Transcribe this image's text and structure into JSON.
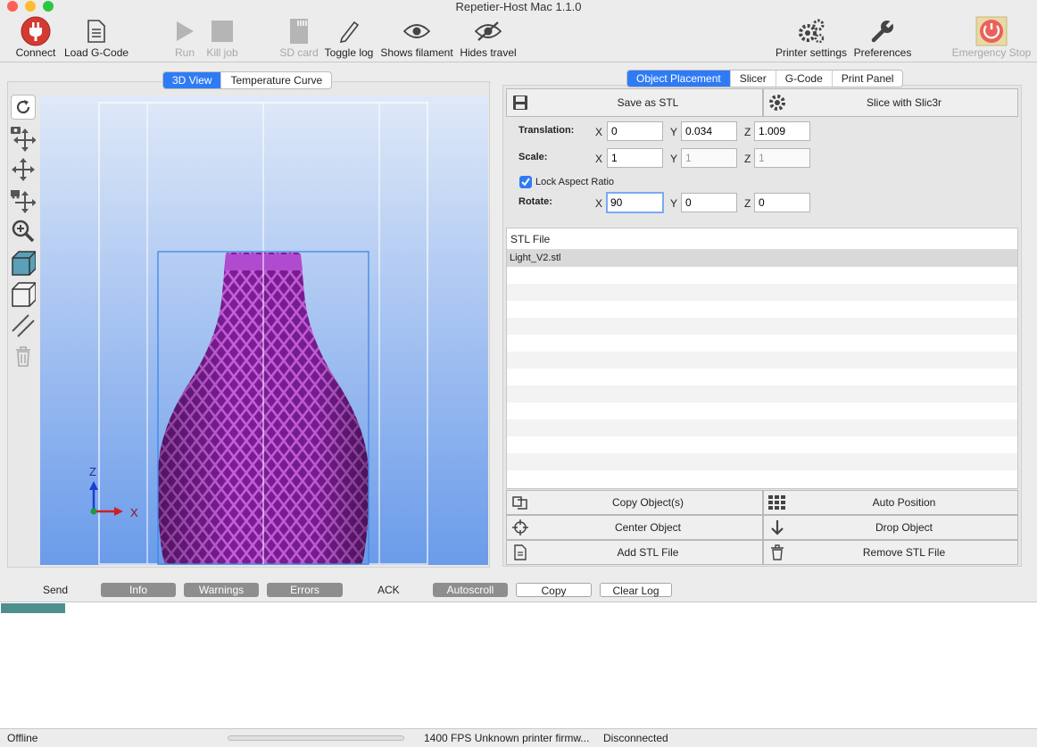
{
  "window": {
    "title": "Repetier-Host Mac 1.1.0"
  },
  "toolbar": {
    "connect": "Connect",
    "load_gcode": "Load G-Code",
    "run": "Run",
    "kill_job": "Kill job",
    "sd_card": "SD card",
    "toggle_log": "Toggle log",
    "shows_filament": "Shows filament",
    "hides_travel": "Hides travel",
    "printer_settings": "Printer settings",
    "preferences": "Preferences",
    "emergency_stop": "Emergency Stop"
  },
  "left_tabs": [
    "3D View",
    "Temperature Curve"
  ],
  "right_tabs": [
    "Object Placement",
    "Slicer",
    "G-Code",
    "Print Panel"
  ],
  "viewport": {
    "axis_z": "Z",
    "axis_x": "X"
  },
  "placement": {
    "save_stl": "Save as STL",
    "slice": "Slice with Slic3r",
    "translation_label": "Translation:",
    "scale_label": "Scale:",
    "rotate_label": "Rotate:",
    "lock_aspect": "Lock Aspect Ratio",
    "lock_checked": true,
    "translation": {
      "x": "0",
      "y": "0.034",
      "z": "1.009"
    },
    "scale": {
      "x": "1",
      "y": "1",
      "z": "1"
    },
    "rotate": {
      "x": "90",
      "y": "0",
      "z": "0"
    }
  },
  "axes": {
    "x": "X",
    "y": "Y",
    "z": "Z"
  },
  "stl_list": {
    "header": "STL File",
    "files": [
      "Light_V2.stl"
    ]
  },
  "actions": {
    "copy": "Copy Object(s)",
    "auto_position": "Auto Position",
    "center": "Center Object",
    "drop": "Drop Object",
    "add": "Add STL File",
    "remove": "Remove STL File"
  },
  "log": {
    "send": "Send",
    "info": "Info",
    "warnings": "Warnings",
    "errors": "Errors",
    "ack": "ACK",
    "autoscroll": "Autoscroll",
    "copy": "Copy",
    "clear": "Clear Log"
  },
  "status": {
    "state": "Offline",
    "info": "1400 FPS Unknown printer firmw...",
    "connection": "Disconnected"
  },
  "colors": {
    "accent": "#2f7bf5",
    "model": "#a42ec2",
    "connect_red": "#d33a32"
  }
}
